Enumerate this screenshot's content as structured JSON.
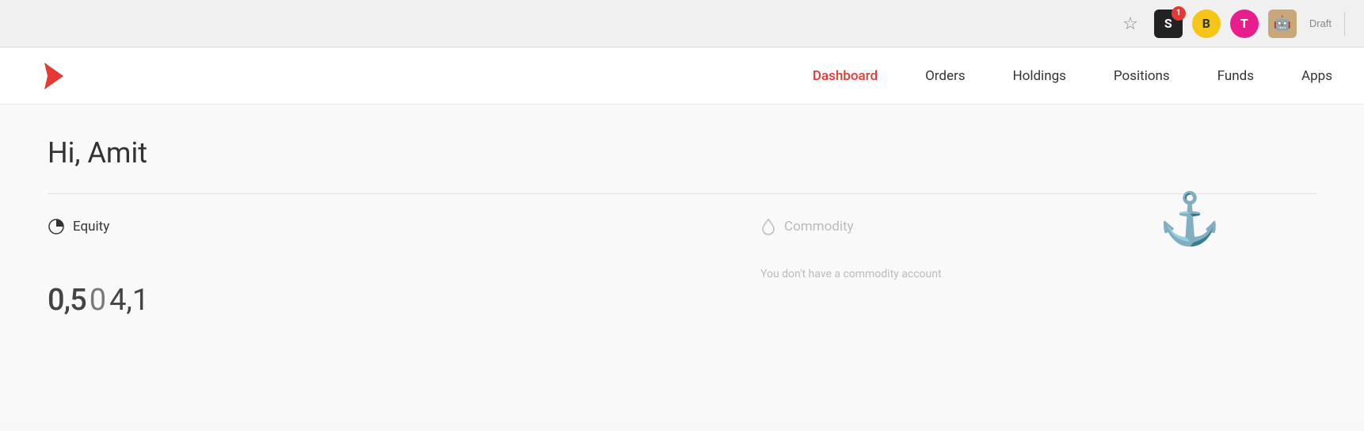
{
  "browser": {
    "star_icon": "☆",
    "icons": [
      {
        "id": "extension-black",
        "type": "black",
        "badge": "1",
        "label": "S"
      },
      {
        "id": "extension-yellow",
        "type": "yellow",
        "badge": null,
        "label": "B"
      },
      {
        "id": "extension-pink",
        "type": "pink",
        "badge": null,
        "label": "T"
      },
      {
        "id": "extension-tan",
        "type": "tan",
        "badge": null,
        "label": "🤖"
      }
    ],
    "draft_label": "Draft"
  },
  "nav": {
    "logo_alt": "Kite logo",
    "links": [
      {
        "id": "dashboard",
        "label": "Dashboard",
        "active": true
      },
      {
        "id": "orders",
        "label": "Orders",
        "active": false
      },
      {
        "id": "holdings",
        "label": "Holdings",
        "active": false
      },
      {
        "id": "positions",
        "label": "Positions",
        "active": false
      },
      {
        "id": "funds",
        "label": "Funds",
        "active": false
      },
      {
        "id": "apps",
        "label": "Apps",
        "active": false
      }
    ]
  },
  "main": {
    "greeting": "Hi, Amit",
    "equity_label": "Equity",
    "commodity_label": "Commodity",
    "no_commodity_text": "You don't have a commodity account",
    "anchor_icon": "⚓"
  }
}
